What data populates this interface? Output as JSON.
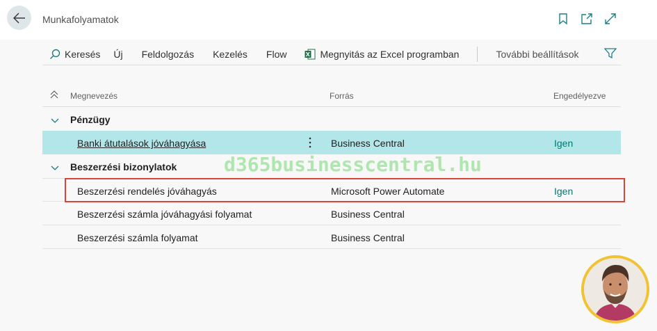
{
  "header": {
    "title": "Munkafolyamatok",
    "icons": [
      "back-arrow-icon",
      "bookmark-icon",
      "open-new-window-icon",
      "expand-icon"
    ]
  },
  "actionbar": {
    "search": "Keresés",
    "new": "Új",
    "process": "Feldolgozás",
    "manage": "Kezelés",
    "flow": "Flow",
    "open_excel": "Megnyitás az Excel programban",
    "more_options": "További beállítások"
  },
  "columns": {
    "name": "Megnevezés",
    "source": "Forrás",
    "enabled": "Engedélyezve"
  },
  "groups": [
    {
      "name": "Pénzügy",
      "rows": [
        {
          "name": "Banki átutalások jóváhagyása",
          "source": "Business Central",
          "enabled": "Igen"
        }
      ]
    },
    {
      "name": "Beszerzési bizonylatok",
      "rows": [
        {
          "name": "Beszerzési rendelés jóváhagyás",
          "source": "Microsoft Power Automate",
          "enabled": "Igen"
        },
        {
          "name": "Beszerzési számla jóváhagyási folyamat",
          "source": "Business Central",
          "enabled": ""
        },
        {
          "name": "Beszerzési számla folyamat",
          "source": "Business Central",
          "enabled": ""
        }
      ]
    }
  ],
  "watermark": "d365businesscentral.hu",
  "colors": {
    "accent": "#00786f",
    "selected_row": "#b3e6e9",
    "highlight_border": "#d8433c",
    "watermark": "#8fe08f",
    "avatar_ring": "#f1c232"
  }
}
